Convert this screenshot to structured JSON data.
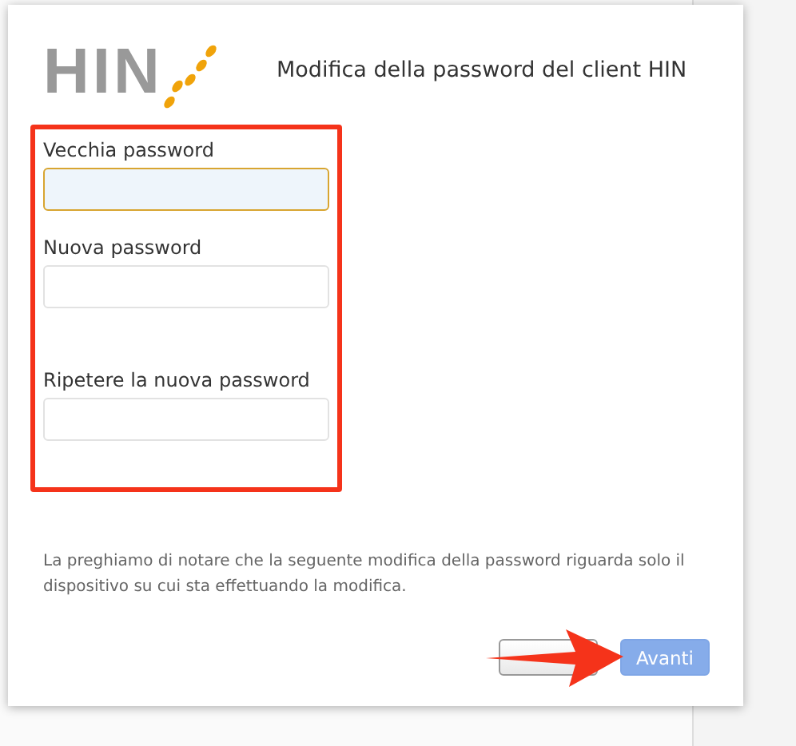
{
  "dialog": {
    "logo": {
      "text": "HIN"
    },
    "title": "Modifica della password del client HIN",
    "fields": [
      {
        "label": "Vecchia password",
        "focused": true
      },
      {
        "label": "Nuova password",
        "focused": false
      },
      {
        "label": "Ripetere la nuova password",
        "focused": false
      }
    ],
    "note": "La preghiamo di notare che la seguente modifica della password riguarda solo il dispositivo su cui sta effettuando la modifica.",
    "buttons": [
      {
        "kind": "cancel"
      },
      {
        "kind": "next",
        "label": "Avanti",
        "disabled": true
      }
    ]
  }
}
